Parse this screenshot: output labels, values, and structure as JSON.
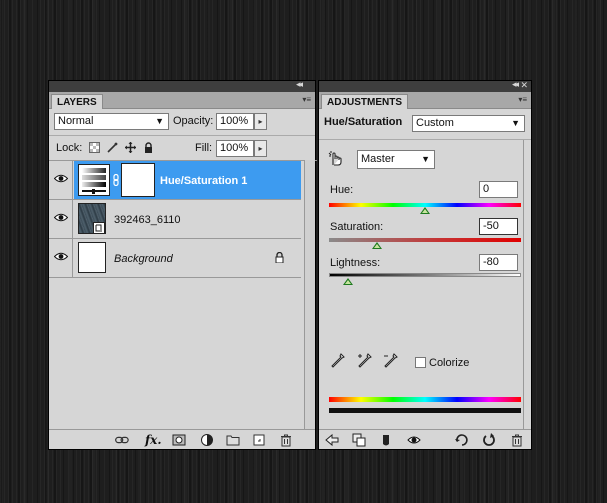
{
  "layers_panel": {
    "tab_label": "LAYERS",
    "blend_mode": "Normal",
    "opacity_label": "Opacity:",
    "opacity_value": "100%",
    "lock_label": "Lock:",
    "fill_label": "Fill:",
    "fill_value": "100%",
    "layers": [
      {
        "name": "Hue/Saturation 1",
        "type": "adjustment",
        "selected": true,
        "visible": true
      },
      {
        "name": "392463_6110",
        "type": "smart-object",
        "selected": false,
        "visible": true
      },
      {
        "name": "Background",
        "type": "background",
        "selected": false,
        "visible": true,
        "locked": true
      }
    ],
    "footer_icons": [
      "link-icon",
      "fx-icon",
      "mask-icon",
      "adjustment-icon",
      "folder-icon",
      "new-layer-icon",
      "trash-icon"
    ]
  },
  "adjustments_panel": {
    "tab_label": "ADJUSTMENTS",
    "title": "Hue/Saturation",
    "preset": "Custom",
    "channel": "Master",
    "hue_label": "Hue:",
    "hue_value": "0",
    "saturation_label": "Saturation:",
    "saturation_value": "-50",
    "lightness_label": "Lightness:",
    "lightness_value": "-80",
    "colorize_label": "Colorize",
    "colorize_checked": false,
    "footer_icons": [
      "back-arrow-icon",
      "clip-icon",
      "visibility-toggle-icon",
      "eye-icon",
      "view-previous-icon",
      "reset-icon",
      "trash-icon"
    ]
  },
  "colors": {
    "selection": "#3d9bf0",
    "panel_bg": "#d6d6d6",
    "chrome_dark": "#3e3e3e"
  }
}
